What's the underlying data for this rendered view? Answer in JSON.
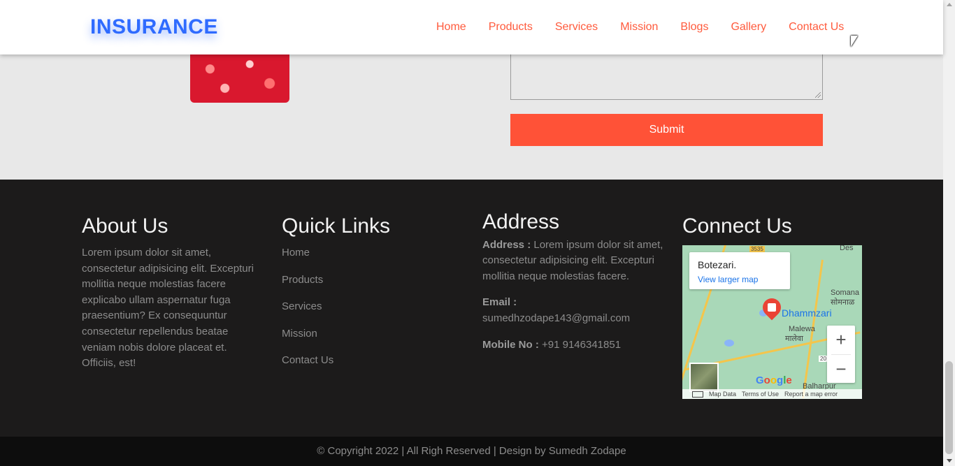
{
  "navbar": {
    "brand": "INSURANCE",
    "links": [
      "Home",
      "Products",
      "Services",
      "Mission",
      "Blogs",
      "Gallery",
      "Contact Us"
    ]
  },
  "form": {
    "submit_label": "Submit"
  },
  "footer": {
    "about": {
      "heading": "About Us",
      "text": "Lorem ipsum dolor sit amet, consectetur adipisicing elit. Excepturi mollitia neque molestias facere explicabo ullam aspernatur fuga praesentium? Ex consequuntur consectetur repellendus beatae veniam nobis dolore placeat et. Officiis, est!"
    },
    "quick_links": {
      "heading": "Quick Links",
      "items": [
        "Home",
        "Products",
        "Services",
        "Mission",
        "Contact Us"
      ]
    },
    "address": {
      "heading": "Address",
      "address_label": "Address :",
      "address_value": "Lorem ipsum dolor sit amet, consectetur adipisicing elit. Excepturi mollitia neque molestias facere.",
      "email_label": "Email :",
      "email_value": "sumedhzodape143@gmail.com",
      "mobile_label": "Mobile No :",
      "mobile_value": "+91 9146341851"
    },
    "connect": {
      "heading": "Connect Us",
      "map": {
        "place_name": "Botezari.",
        "view_larger": "View larger map",
        "marker_label": "Dhammzari",
        "labels": [
          "Des",
          "Somana",
          "सोमनाळ",
          "Malewa",
          "मालेवा",
          "Balharpur",
          "3535",
          "20"
        ],
        "zoom_in": "+",
        "zoom_out": "−",
        "google": "Google",
        "footer": [
          "Map Data",
          "Terms of Use",
          "Report a map error"
        ]
      }
    },
    "copyright": "© Copyright 2022 | All Righ Reserved | Design by Sumedh Zodape"
  },
  "colors": {
    "brand": "#2f6bff",
    "nav_link": "#ff5a3c",
    "submit": "#ff5237",
    "footer_bg": "#1c1b1b",
    "copy_bg": "#0d0d0d"
  },
  "scrollbar": {
    "position_fraction": 0.95
  }
}
